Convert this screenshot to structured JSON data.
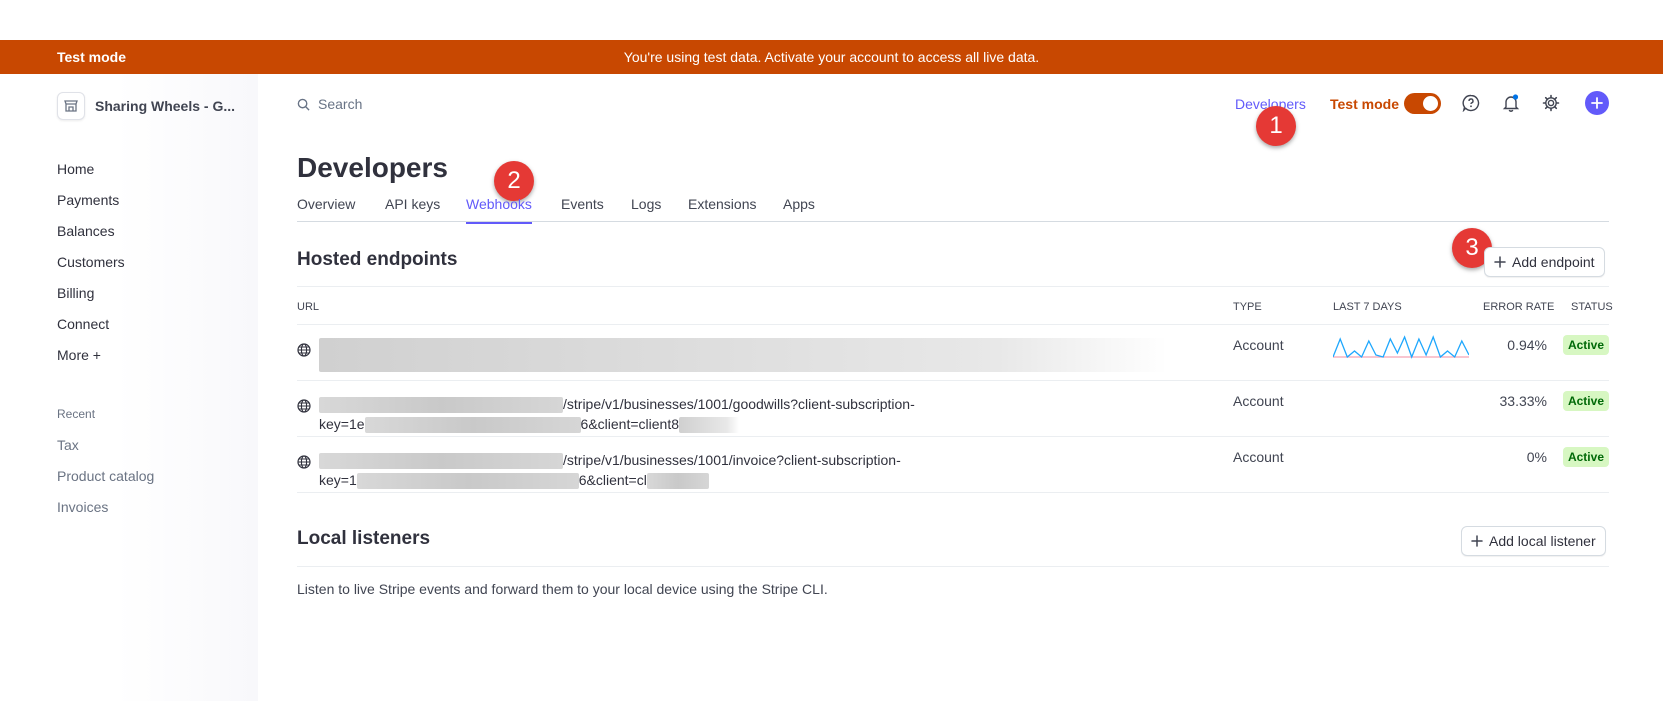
{
  "banner": {
    "mode": "Test mode",
    "message": "You're using test data. Activate your account to access all live data."
  },
  "account": {
    "name": "Sharing Wheels - G...",
    "icon": "store-icon"
  },
  "search": {
    "placeholder": "Search",
    "icon": "search-icon"
  },
  "nav": {
    "items": [
      {
        "label": "Home"
      },
      {
        "label": "Payments"
      },
      {
        "label": "Balances"
      },
      {
        "label": "Customers"
      },
      {
        "label": "Billing"
      },
      {
        "label": "Connect"
      },
      {
        "label": "More +"
      }
    ],
    "recent_title": "Recent",
    "recent": [
      {
        "label": "Tax"
      },
      {
        "label": "Product catalog"
      },
      {
        "label": "Invoices"
      }
    ]
  },
  "toolbar": {
    "developers": "Developers",
    "test_mode": "Test mode",
    "toggle_on": true,
    "icons": [
      "help-icon",
      "notification-bell-icon",
      "settings-gear-icon",
      "create-plus-icon"
    ]
  },
  "annotations": [
    "1",
    "2",
    "3"
  ],
  "page": {
    "title": "Developers",
    "tabs": [
      {
        "label": "Overview"
      },
      {
        "label": "API keys"
      },
      {
        "label": "Webhooks",
        "active": true
      },
      {
        "label": "Events"
      },
      {
        "label": "Logs"
      },
      {
        "label": "Extensions"
      },
      {
        "label": "Apps"
      }
    ]
  },
  "hosted": {
    "title": "Hosted endpoints",
    "add_button": "Add endpoint",
    "columns": {
      "url": "URL",
      "type": "TYPE",
      "last7": "LAST 7 DAYS",
      "error_rate": "ERROR RATE",
      "status": "STATUS"
    },
    "rows": [
      {
        "url_line1": "",
        "url_line2": "",
        "type": "Account",
        "error_rate": "0.94%",
        "status": "Active",
        "has_sparkline": true
      },
      {
        "url_line1": "/stripe/v1/businesses/1001/goodwills?client-subscription-",
        "url_line2_prefix": "key=1e",
        "url_line2_mid": "6&client=client8",
        "type": "Account",
        "error_rate": "33.33%",
        "status": "Active"
      },
      {
        "url_line1": "/stripe/v1/businesses/1001/invoice?client-subscription-",
        "url_line2_prefix": "key=1",
        "url_line2_mid": "6&client=cl",
        "type": "Account",
        "error_rate": "0%",
        "status": "Active"
      }
    ]
  },
  "local": {
    "title": "Local listeners",
    "add_button": "Add local listener",
    "description": "Listen to live Stripe events and forward them to your local device using the Stripe CLI."
  },
  "colors": {
    "accent": "#625afa",
    "test_mode": "#c84801",
    "active_bg": "#d7f7c2",
    "active_text": "#006908",
    "sparkline": "#1ea7fd",
    "annotation": "#e53935"
  }
}
